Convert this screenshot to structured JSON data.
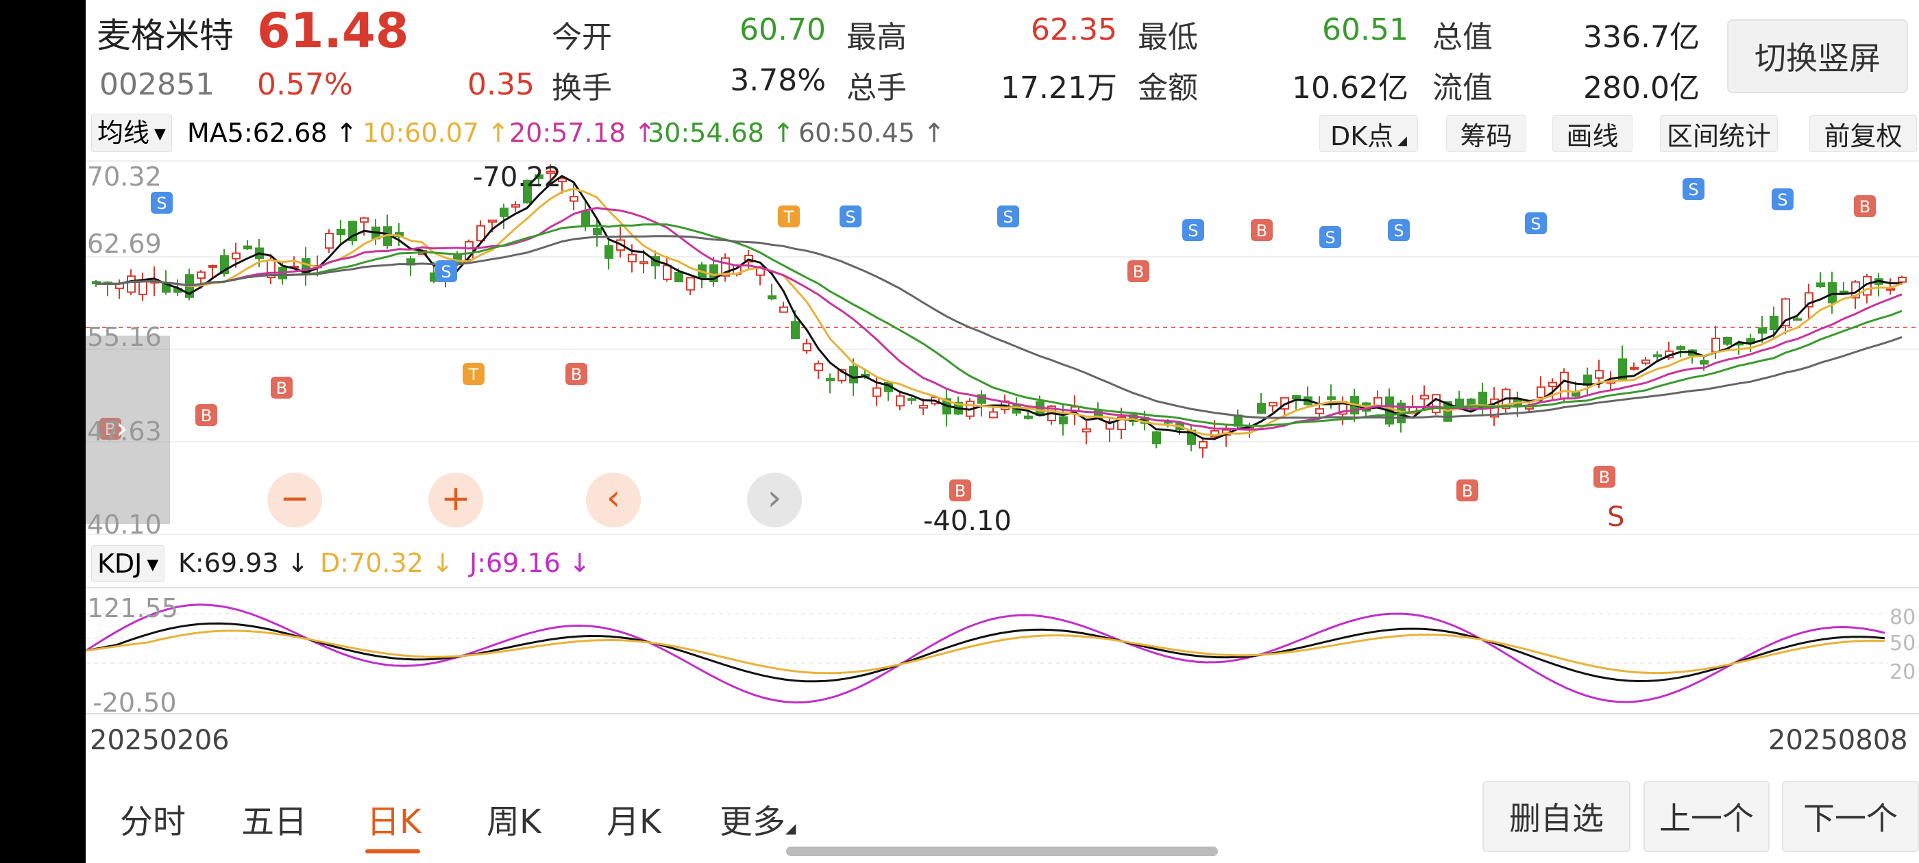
{
  "quote": {
    "name": "麦格米特",
    "price": "61.48",
    "code": "002851",
    "change_pct": "0.57%",
    "change": "0.35",
    "fields": [
      {
        "label": "今开",
        "value": "60.70",
        "color": "green"
      },
      {
        "label": "最高",
        "value": "62.35",
        "color": "red"
      },
      {
        "label": "最低",
        "value": "60.51",
        "color": "green"
      },
      {
        "label": "总值",
        "value": "336.7亿",
        "color": "dark"
      },
      {
        "label": "换手",
        "value": "3.78%",
        "color": "dark"
      },
      {
        "label": "总手",
        "value": "17.21万",
        "color": "dark"
      },
      {
        "label": "金额",
        "value": "10.62亿",
        "color": "dark"
      },
      {
        "label": "流值",
        "value": "280.0亿",
        "color": "dark"
      }
    ],
    "switch_button": "切换竖屏"
  },
  "ma_bar": {
    "selector": "均线",
    "items": [
      {
        "text": "MA5:62.68 ↑",
        "color": "#222222"
      },
      {
        "text": "10:60.07 ↑",
        "color": "#e8b23a"
      },
      {
        "text": "20:57.18 ↑",
        "color": "#c8359c"
      },
      {
        "text": "30:54.68 ↑",
        "color": "#3a9a2e"
      },
      {
        "text": "60:50.45 ↑",
        "color": "#666666"
      }
    ],
    "tools": [
      "DK点",
      "筹码",
      "画线",
      "区间统计",
      "前复权"
    ]
  },
  "main_chart": {
    "y_labels": [
      "70.32",
      "62.69",
      "55.16",
      "47.63",
      "40.10"
    ],
    "high_marker": "-70.22",
    "low_marker": "-40.10",
    "s_marker": "S"
  },
  "kdj_bar": {
    "selector": "KDJ",
    "items": [
      {
        "text": "K:69.93 ↓",
        "color": "#222222"
      },
      {
        "text": "D:70.32 ↓",
        "color": "#e8b23a"
      },
      {
        "text": "J:69.16 ↓",
        "color": "#c02fc8"
      }
    ],
    "y_top": "121.55",
    "y_bottom": "-20.50",
    "levels": [
      "80",
      "50",
      "20"
    ]
  },
  "dates": {
    "start": "20250206",
    "end": "20250808"
  },
  "bottom_tabs": [
    "分时",
    "五日",
    "日K",
    "周K",
    "月K",
    "更多"
  ],
  "active_tab": "日K",
  "actions": [
    "删自选",
    "上一个",
    "下一个"
  ],
  "icons": {
    "zoom_out": "minus-icon",
    "zoom_in": "plus-icon",
    "back": "chevron-left-icon",
    "forward": "chevron-right-icon"
  },
  "colors": {
    "up": "#d93a2e",
    "down": "#3a9a2e",
    "accent": "#e25b1c",
    "buy_marker": "#e26a5a",
    "sell_marker": "#4a90e8",
    "t_marker": "#f0a030"
  }
}
